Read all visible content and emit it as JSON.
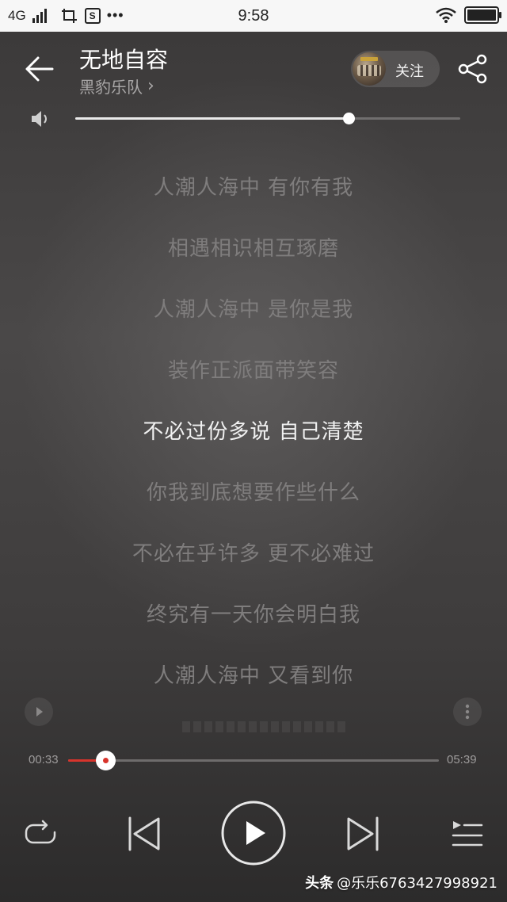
{
  "status_bar": {
    "network": "4G",
    "time": "9:58",
    "sim_icon": "S"
  },
  "header": {
    "title": "无地自容",
    "artist": "黑豹乐队",
    "artist_chevron": "›",
    "follow_label": "关注"
  },
  "volume": {
    "level": 0.71
  },
  "lyrics": [
    "人潮人海中 有你有我",
    "相遇相识相互琢磨",
    "人潮人海中 是你是我",
    "装作正派面带笑容",
    "不必过份多说 自己清楚",
    "你我到底想要作些什么",
    "不必在乎许多 更不必难过",
    "终究有一天你会明白我",
    "人潮人海中 又看到你"
  ],
  "current_lyric_index": 4,
  "playback": {
    "current_time": "00:33",
    "total_time": "05:39",
    "progress": 0.1
  },
  "watermark": {
    "brand": "头条",
    "handle": "@乐乐6763427998921"
  },
  "colors": {
    "accent": "#d8342c",
    "lyric_dim": "#7f7d7d",
    "lyric_current": "#f1f1f1"
  },
  "icons": [
    "back-arrow-icon",
    "share-icon",
    "speaker-icon",
    "play-icon",
    "more-vertical-icon",
    "repeat-icon",
    "skip-previous-icon",
    "skip-next-icon",
    "playlist-icon",
    "wifi-icon",
    "battery-icon"
  ]
}
